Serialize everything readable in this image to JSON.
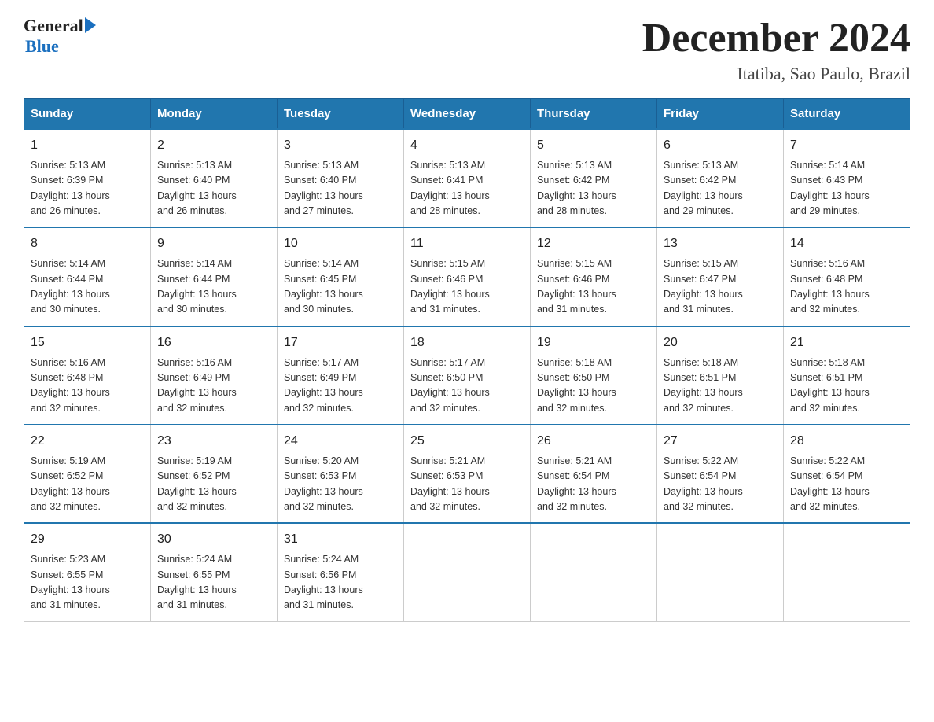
{
  "header": {
    "logo_general": "General",
    "logo_blue": "Blue",
    "title": "December 2024",
    "subtitle": "Itatiba, Sao Paulo, Brazil"
  },
  "weekdays": [
    "Sunday",
    "Monday",
    "Tuesday",
    "Wednesday",
    "Thursday",
    "Friday",
    "Saturday"
  ],
  "weeks": [
    [
      {
        "day": "1",
        "sunrise": "5:13 AM",
        "sunset": "6:39 PM",
        "daylight": "13 hours and 26 minutes."
      },
      {
        "day": "2",
        "sunrise": "5:13 AM",
        "sunset": "6:40 PM",
        "daylight": "13 hours and 26 minutes."
      },
      {
        "day": "3",
        "sunrise": "5:13 AM",
        "sunset": "6:40 PM",
        "daylight": "13 hours and 27 minutes."
      },
      {
        "day": "4",
        "sunrise": "5:13 AM",
        "sunset": "6:41 PM",
        "daylight": "13 hours and 28 minutes."
      },
      {
        "day": "5",
        "sunrise": "5:13 AM",
        "sunset": "6:42 PM",
        "daylight": "13 hours and 28 minutes."
      },
      {
        "day": "6",
        "sunrise": "5:13 AM",
        "sunset": "6:42 PM",
        "daylight": "13 hours and 29 minutes."
      },
      {
        "day": "7",
        "sunrise": "5:14 AM",
        "sunset": "6:43 PM",
        "daylight": "13 hours and 29 minutes."
      }
    ],
    [
      {
        "day": "8",
        "sunrise": "5:14 AM",
        "sunset": "6:44 PM",
        "daylight": "13 hours and 30 minutes."
      },
      {
        "day": "9",
        "sunrise": "5:14 AM",
        "sunset": "6:44 PM",
        "daylight": "13 hours and 30 minutes."
      },
      {
        "day": "10",
        "sunrise": "5:14 AM",
        "sunset": "6:45 PM",
        "daylight": "13 hours and 30 minutes."
      },
      {
        "day": "11",
        "sunrise": "5:15 AM",
        "sunset": "6:46 PM",
        "daylight": "13 hours and 31 minutes."
      },
      {
        "day": "12",
        "sunrise": "5:15 AM",
        "sunset": "6:46 PM",
        "daylight": "13 hours and 31 minutes."
      },
      {
        "day": "13",
        "sunrise": "5:15 AM",
        "sunset": "6:47 PM",
        "daylight": "13 hours and 31 minutes."
      },
      {
        "day": "14",
        "sunrise": "5:16 AM",
        "sunset": "6:48 PM",
        "daylight": "13 hours and 32 minutes."
      }
    ],
    [
      {
        "day": "15",
        "sunrise": "5:16 AM",
        "sunset": "6:48 PM",
        "daylight": "13 hours and 32 minutes."
      },
      {
        "day": "16",
        "sunrise": "5:16 AM",
        "sunset": "6:49 PM",
        "daylight": "13 hours and 32 minutes."
      },
      {
        "day": "17",
        "sunrise": "5:17 AM",
        "sunset": "6:49 PM",
        "daylight": "13 hours and 32 minutes."
      },
      {
        "day": "18",
        "sunrise": "5:17 AM",
        "sunset": "6:50 PM",
        "daylight": "13 hours and 32 minutes."
      },
      {
        "day": "19",
        "sunrise": "5:18 AM",
        "sunset": "6:50 PM",
        "daylight": "13 hours and 32 minutes."
      },
      {
        "day": "20",
        "sunrise": "5:18 AM",
        "sunset": "6:51 PM",
        "daylight": "13 hours and 32 minutes."
      },
      {
        "day": "21",
        "sunrise": "5:18 AM",
        "sunset": "6:51 PM",
        "daylight": "13 hours and 32 minutes."
      }
    ],
    [
      {
        "day": "22",
        "sunrise": "5:19 AM",
        "sunset": "6:52 PM",
        "daylight": "13 hours and 32 minutes."
      },
      {
        "day": "23",
        "sunrise": "5:19 AM",
        "sunset": "6:52 PM",
        "daylight": "13 hours and 32 minutes."
      },
      {
        "day": "24",
        "sunrise": "5:20 AM",
        "sunset": "6:53 PM",
        "daylight": "13 hours and 32 minutes."
      },
      {
        "day": "25",
        "sunrise": "5:21 AM",
        "sunset": "6:53 PM",
        "daylight": "13 hours and 32 minutes."
      },
      {
        "day": "26",
        "sunrise": "5:21 AM",
        "sunset": "6:54 PM",
        "daylight": "13 hours and 32 minutes."
      },
      {
        "day": "27",
        "sunrise": "5:22 AM",
        "sunset": "6:54 PM",
        "daylight": "13 hours and 32 minutes."
      },
      {
        "day": "28",
        "sunrise": "5:22 AM",
        "sunset": "6:54 PM",
        "daylight": "13 hours and 32 minutes."
      }
    ],
    [
      {
        "day": "29",
        "sunrise": "5:23 AM",
        "sunset": "6:55 PM",
        "daylight": "13 hours and 31 minutes."
      },
      {
        "day": "30",
        "sunrise": "5:24 AM",
        "sunset": "6:55 PM",
        "daylight": "13 hours and 31 minutes."
      },
      {
        "day": "31",
        "sunrise": "5:24 AM",
        "sunset": "6:56 PM",
        "daylight": "13 hours and 31 minutes."
      },
      null,
      null,
      null,
      null
    ]
  ],
  "labels": {
    "sunrise": "Sunrise:",
    "sunset": "Sunset:",
    "daylight": "Daylight:"
  }
}
